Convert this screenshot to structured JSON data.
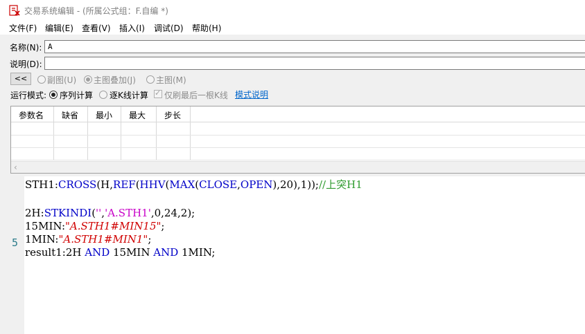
{
  "window": {
    "title": "交易系统编辑 - (所属公式组：F.自编 *)"
  },
  "menu": [
    "文件(F)",
    "编辑(E)",
    "查看(V)",
    "插入(I)",
    "调试(D)",
    "帮助(H)"
  ],
  "fields": {
    "name_label": "名称(N):",
    "name_value": "A",
    "desc_label": "说明(D):",
    "desc_value": ""
  },
  "options": {
    "collapse_label": "<<",
    "sub_chart": "副图(U)",
    "main_overlay": "主图叠加(J)",
    "main_chart": "主图(M)"
  },
  "mode": {
    "label": "运行模式:",
    "sequential": "序列计算",
    "per_bar": "逐K线计算",
    "last_bar_only": "仅刷最后一根K线",
    "help_link": "模式说明"
  },
  "param_table": {
    "headers": [
      "参数名",
      "缺省",
      "最小",
      "最大",
      "步长"
    ]
  },
  "editor": {
    "line_marker": "5",
    "lines": [
      [
        [
          "",
          "STH1:"
        ],
        [
          "kw",
          "CROSS"
        ],
        [
          "",
          "(H,"
        ],
        [
          "kw",
          "REF"
        ],
        [
          "",
          "("
        ],
        [
          "kw",
          "HHV"
        ],
        [
          "",
          "("
        ],
        [
          "kw",
          "MAX"
        ],
        [
          "",
          "("
        ],
        [
          "kw",
          "CLOSE"
        ],
        [
          "",
          ","
        ],
        [
          "kw",
          "OPEN"
        ],
        [
          "",
          "),20),1));"
        ],
        [
          "cmt",
          "//上突H1"
        ]
      ],
      [],
      [
        [
          "",
          "2H:"
        ],
        [
          "kw",
          "STKINDI"
        ],
        [
          "",
          "("
        ],
        [
          "sq",
          "''"
        ],
        [
          "",
          ","
        ],
        [
          "sq",
          "'A.STH1'"
        ],
        [
          "",
          ",0,24,2);"
        ]
      ],
      [
        [
          "",
          "15MIN:"
        ],
        [
          "str",
          "\"A.STH1#MIN15\""
        ],
        [
          "",
          ";"
        ]
      ],
      [
        [
          "",
          "1MIN:"
        ],
        [
          "str",
          "\"A.STH1#MIN1\""
        ],
        [
          "",
          ";"
        ]
      ],
      [
        [
          "",
          "result1:2H "
        ],
        [
          "kw",
          "AND"
        ],
        [
          "",
          " 15MIN "
        ],
        [
          "kw",
          "AND"
        ],
        [
          "",
          " 1MIN;"
        ]
      ]
    ]
  },
  "colors": {
    "keyword": "#0000c8",
    "string": "#d00000",
    "comment": "#2e9b2e",
    "link": "#0066cc"
  }
}
